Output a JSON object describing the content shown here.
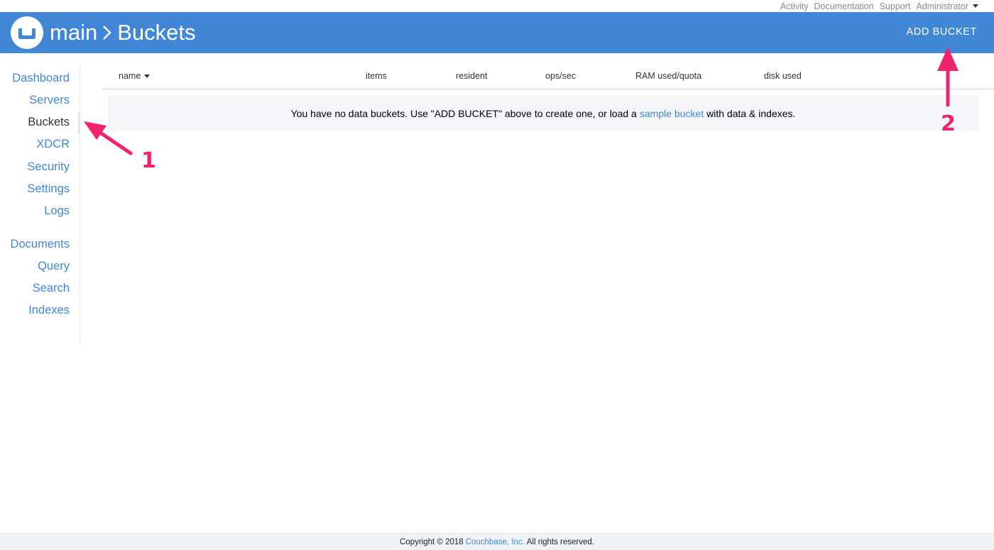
{
  "topnav": {
    "activity": "Activity",
    "documentation": "Documentation",
    "support": "Support",
    "administrator": "Administrator"
  },
  "header": {
    "cluster": "main",
    "page": "Buckets",
    "add_bucket": "ADD BUCKET"
  },
  "sidebar": {
    "items": [
      "Dashboard",
      "Servers",
      "Buckets",
      "XDCR",
      "Security",
      "Settings",
      "Logs",
      "Documents",
      "Query",
      "Search",
      "Indexes"
    ],
    "active": "Buckets"
  },
  "table": {
    "columns": [
      "name",
      "items",
      "resident",
      "ops/sec",
      "RAM used/quota",
      "disk used"
    ],
    "empty_prefix": "You have no data buckets. Use \"ADD BUCKET\" above to create one, or load a",
    "empty_link": "sample bucket",
    "empty_suffix": "with data & indexes."
  },
  "footer": {
    "prefix": "Copyright © 2018",
    "company": "Couchbase, Inc.",
    "suffix": "All rights reserved."
  },
  "annotations": [
    "1",
    "2"
  ],
  "colors": {
    "brand_blue": "#4287d6",
    "annotation_pink": "#f0236e"
  },
  "icons": {
    "logo": "couchbase-logo-icon",
    "sort": "caret-down-icon",
    "breadcrumb": "chevron-right-icon"
  }
}
